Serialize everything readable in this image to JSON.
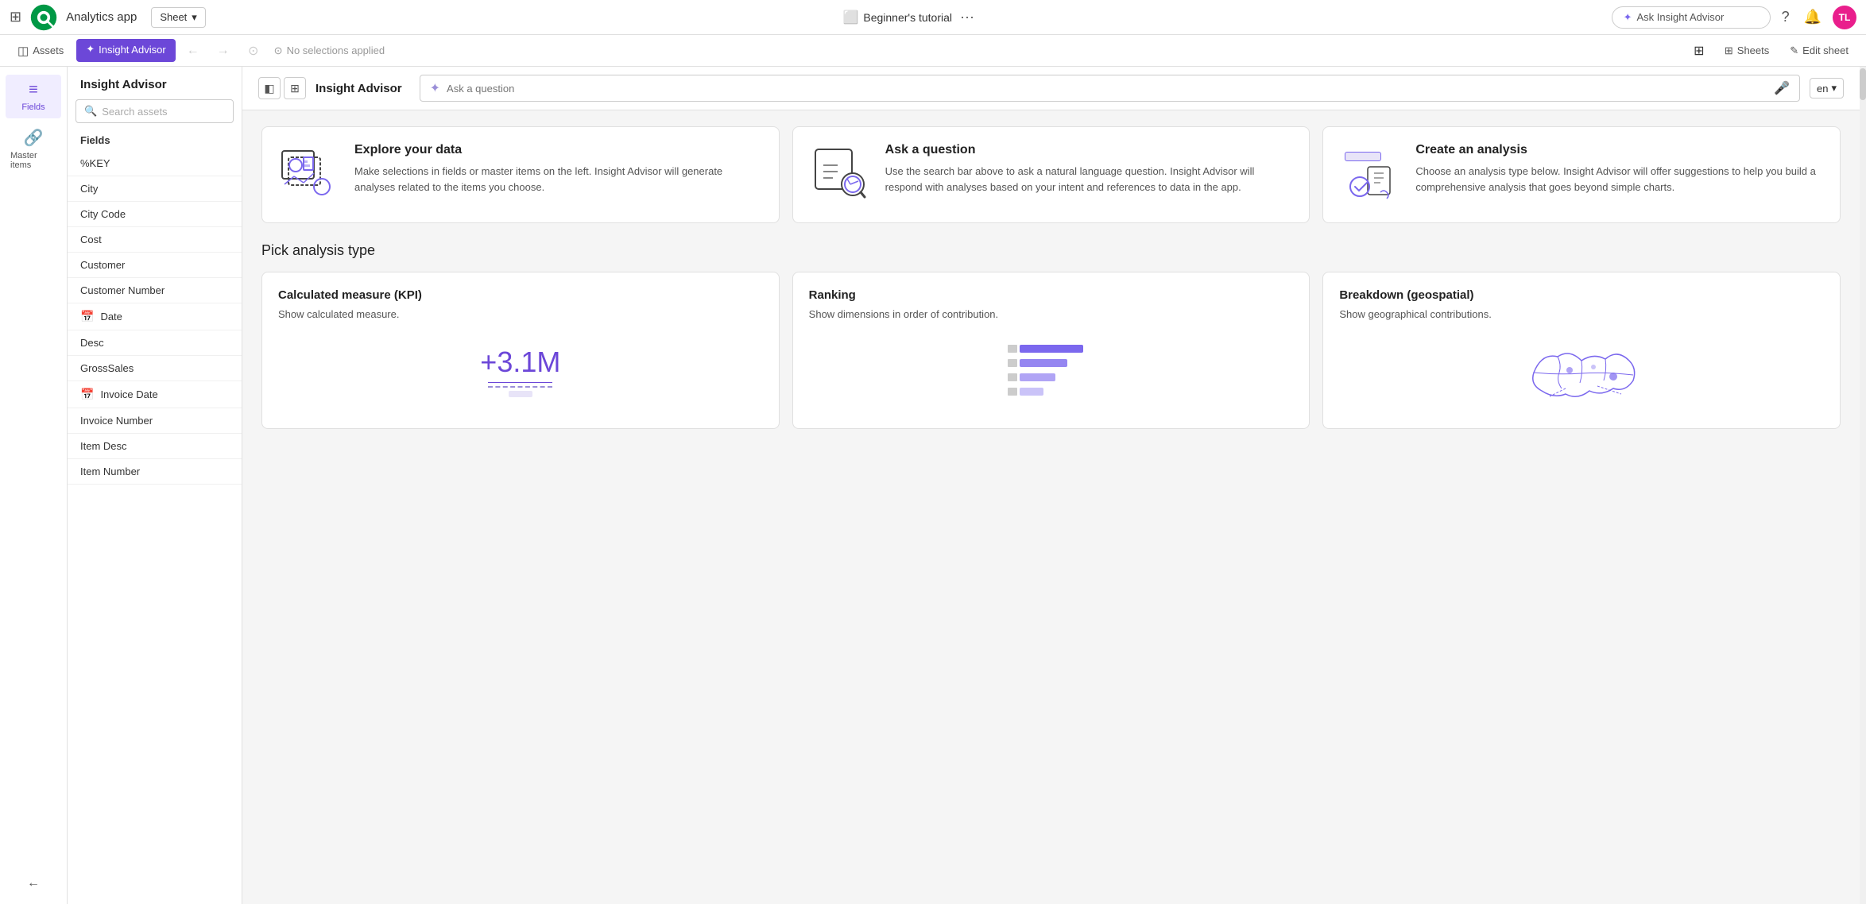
{
  "topNav": {
    "appTitle": "Analytics app",
    "sheetDropdown": "Sheet",
    "tutorialLabel": "Beginner's tutorial",
    "askAdvisorPlaceholder": "Ask Insight Advisor",
    "avatarInitials": "TL"
  },
  "toolbar": {
    "assetsLabel": "Assets",
    "insightAdvisorLabel": "Insight Advisor",
    "noSelectionsLabel": "No selections applied",
    "sheetsLabel": "Sheets",
    "editSheetLabel": "Edit sheet"
  },
  "sidebar": {
    "title": "Insight Advisor",
    "searchPlaceholder": "Search assets",
    "fieldsLabel": "Fields",
    "fields": [
      {
        "name": "%KEY",
        "hasIcon": false
      },
      {
        "name": "City",
        "hasIcon": false
      },
      {
        "name": "City Code",
        "hasIcon": false
      },
      {
        "name": "Cost",
        "hasIcon": false
      },
      {
        "name": "Customer",
        "hasIcon": false
      },
      {
        "name": "Customer Number",
        "hasIcon": false
      },
      {
        "name": "Date",
        "hasIcon": true
      },
      {
        "name": "Desc",
        "hasIcon": false
      },
      {
        "name": "GrossSales",
        "hasIcon": false
      },
      {
        "name": "Invoice Date",
        "hasIcon": true
      },
      {
        "name": "Invoice Number",
        "hasIcon": false
      },
      {
        "name": "Item Desc",
        "hasIcon": false
      },
      {
        "name": "Item Number",
        "hasIcon": false
      }
    ],
    "masterItemsLabel": "Master items"
  },
  "insightAdvisor": {
    "title": "Insight Advisor",
    "askPlaceholder": "Ask a question",
    "langLabel": "en"
  },
  "infoCards": [
    {
      "id": "explore",
      "title": "Explore your data",
      "desc": "Make selections in fields or master items on the left. Insight Advisor will generate analyses related to the items you choose."
    },
    {
      "id": "ask",
      "title": "Ask a question",
      "desc": "Use the search bar above to ask a natural language question. Insight Advisor will respond with analyses based on your intent and references to data in the app."
    },
    {
      "id": "create",
      "title": "Create an analysis",
      "desc": "Choose an analysis type below. Insight Advisor will offer suggestions to help you build a comprehensive analysis that goes beyond simple charts."
    }
  ],
  "pickAnalysis": {
    "sectionTitle": "Pick analysis type",
    "cards": [
      {
        "id": "kpi",
        "title": "Calculated measure (KPI)",
        "desc": "Show calculated measure.",
        "kpiValue": "+3.1M"
      },
      {
        "id": "ranking",
        "title": "Ranking",
        "desc": "Show dimensions in order of contribution."
      },
      {
        "id": "geo",
        "title": "Breakdown (geospatial)",
        "desc": "Show geographical contributions."
      }
    ]
  },
  "leftPanel": {
    "fieldsLabel": "Fields",
    "masterItemsLabel": "Master items"
  }
}
